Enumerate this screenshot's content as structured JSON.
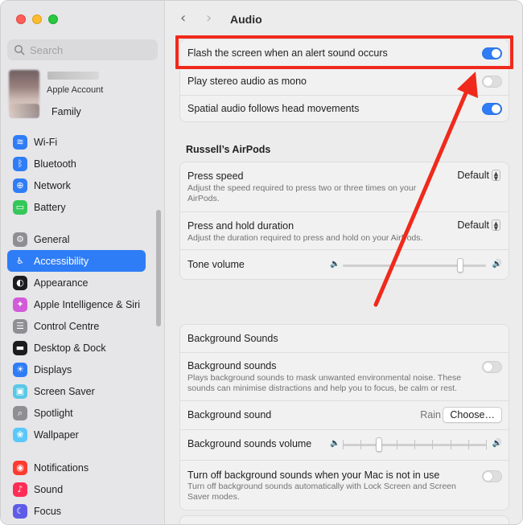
{
  "sidebar": {
    "search_placeholder": "Search",
    "account_label": "Apple Account",
    "family_label": "Family",
    "group1": [
      {
        "label": "Wi-Fi",
        "icon": "wifi-icon",
        "color": "#2f7df6",
        "glyph": "≋"
      },
      {
        "label": "Bluetooth",
        "icon": "bluetooth-icon",
        "color": "#2f7df6",
        "glyph": "ᛒ"
      },
      {
        "label": "Network",
        "icon": "network-globe-icon",
        "color": "#2f7df6",
        "glyph": "⊕"
      },
      {
        "label": "Battery",
        "icon": "battery-icon",
        "color": "#34c759",
        "glyph": "▭"
      }
    ],
    "group2": [
      {
        "label": "General",
        "icon": "gear-icon",
        "color": "#8e8e93",
        "glyph": "⚙"
      },
      {
        "label": "Accessibility",
        "icon": "accessibility-icon",
        "color": "#2f7df6",
        "glyph": "♿",
        "active": true
      },
      {
        "label": "Appearance",
        "icon": "appearance-icon",
        "color": "#1c1c1e",
        "glyph": "◐"
      },
      {
        "label": "Apple Intelligence & Siri",
        "icon": "siri-icon",
        "color": "#d15bd9",
        "glyph": "✦"
      },
      {
        "label": "Control Centre",
        "icon": "control-centre-icon",
        "color": "#8e8e93",
        "glyph": "☰"
      },
      {
        "label": "Desktop & Dock",
        "icon": "desktop-dock-icon",
        "color": "#1c1c1e",
        "glyph": "▬"
      },
      {
        "label": "Displays",
        "icon": "displays-icon",
        "color": "#2f7df6",
        "glyph": "☀"
      },
      {
        "label": "Screen Saver",
        "icon": "screen-saver-icon",
        "color": "#5ac8e6",
        "glyph": "▣"
      },
      {
        "label": "Spotlight",
        "icon": "spotlight-icon",
        "color": "#8e8e93",
        "glyph": "⌕"
      },
      {
        "label": "Wallpaper",
        "icon": "wallpaper-icon",
        "color": "#5ac8fa",
        "glyph": "❀"
      }
    ],
    "group3": [
      {
        "label": "Notifications",
        "icon": "notifications-icon",
        "color": "#ff3b30",
        "glyph": "◉"
      },
      {
        "label": "Sound",
        "icon": "sound-icon",
        "color": "#ff2d55",
        "glyph": "♪"
      },
      {
        "label": "Focus",
        "icon": "focus-moon-icon",
        "color": "#5e5ce6",
        "glyph": "☾"
      }
    ]
  },
  "header": {
    "title": "Audio"
  },
  "card1": {
    "flash": "Flash the screen when an alert sound occurs",
    "flash_on": true,
    "mono": "Play stereo audio as mono",
    "mono_on": false,
    "spatial": "Spatial audio follows head movements",
    "spatial_on": true
  },
  "airpods": {
    "title": "Russell’s AirPods",
    "press_speed_label": "Press speed",
    "press_speed_desc": "Adjust the speed required to press two or three times on your AirPods.",
    "press_speed_value": "Default",
    "hold_label": "Press and hold duration",
    "hold_desc": "Adjust the duration required to press and hold on your AirPods.",
    "hold_value": "Default",
    "tone_label": "Tone volume",
    "tone_level": 0.82
  },
  "background": {
    "header": "Background Sounds",
    "bg_sounds_label": "Background sounds",
    "bg_sounds_desc": "Plays background sounds to mask unwanted environmental noise. These sounds can minimise distractions and help you to focus, be calm or rest.",
    "bg_sounds_on": false,
    "bg_sound_label": "Background sound",
    "bg_sound_value": "Rain",
    "choose_button": "Choose…",
    "volume_label": "Background sounds volume",
    "volume_level": 0.25,
    "turnoff_label": "Turn off background sounds when your Mac is not in use",
    "turnoff_desc": "Turn off background sounds automatically with Lock Screen and Screen Saver modes.",
    "turnoff_on": false
  },
  "annotation_color": "#ef2a1c"
}
